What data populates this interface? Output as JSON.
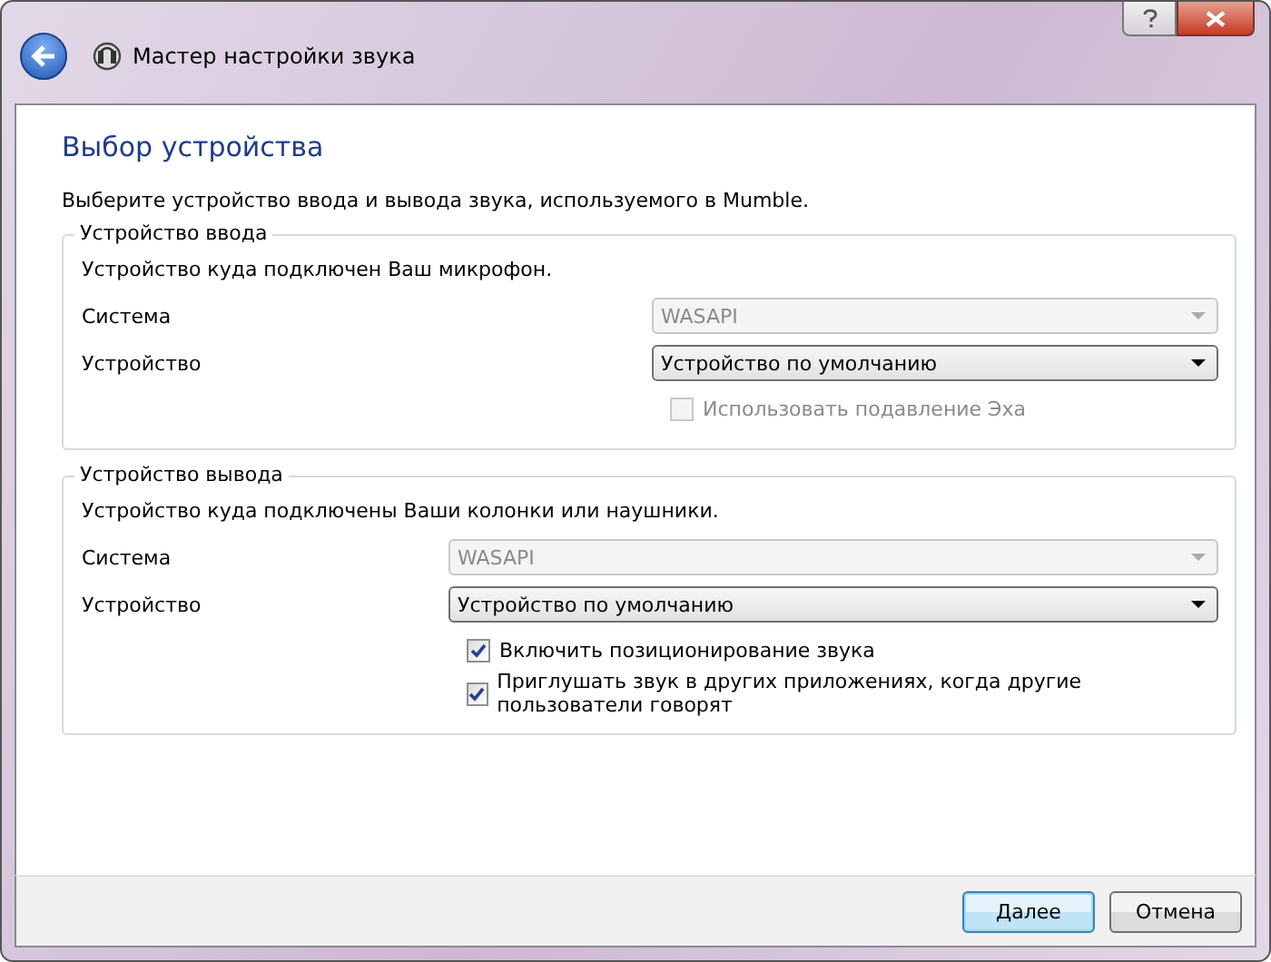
{
  "window": {
    "title": "Мастер настройки звука"
  },
  "page": {
    "heading": "Выбор устройства",
    "intro": "Выберите устройство ввода и вывода звука, используемого в Mumble."
  },
  "groups": [
    {
      "title": "Устройство ввода",
      "description": "Устройство куда подключен Ваш микрофон.",
      "fields": [
        {
          "label": "Система",
          "value": "WASAPI",
          "disabled": true
        },
        {
          "label": "Устройство",
          "value": "Устройство по умолчанию",
          "disabled": false
        }
      ],
      "checkboxes": [
        {
          "label": "Использовать подавление Эха",
          "checked": false,
          "disabled": true
        }
      ]
    },
    {
      "title": "Устройство вывода",
      "description": "Устройство куда подключены Ваши колонки или наушники.",
      "fields": [
        {
          "label": "Система",
          "value": "WASAPI",
          "disabled": true
        },
        {
          "label": "Устройство",
          "value": "Устройство по умолчанию",
          "disabled": false
        }
      ],
      "checkboxes": [
        {
          "label": "Включить позиционирование звука",
          "checked": true,
          "disabled": false
        },
        {
          "label": "Приглушать звук в других приложениях, когда другие пользователи говорят",
          "checked": true,
          "disabled": false
        }
      ]
    }
  ],
  "buttons": [
    {
      "label": "Далее",
      "kind": "default"
    },
    {
      "label": "Отмена",
      "kind": "normal"
    }
  ]
}
